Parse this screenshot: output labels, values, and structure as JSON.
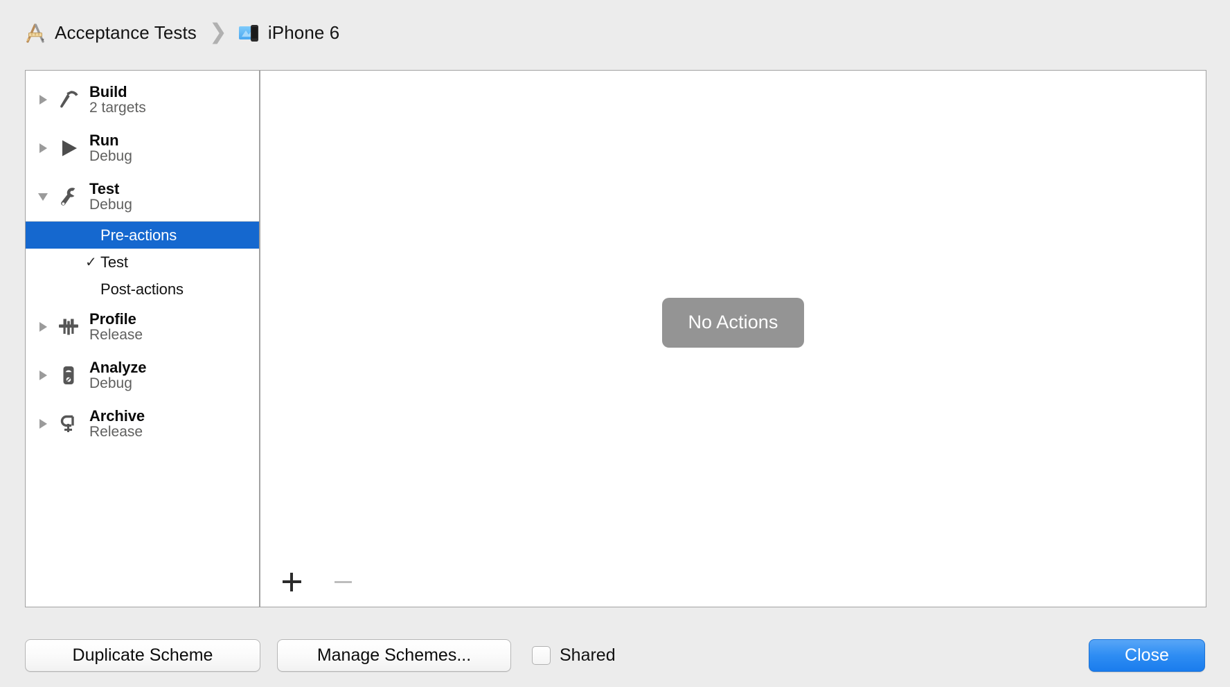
{
  "breadcrumb": {
    "scheme_icon": "scheme-icon",
    "scheme_name": "Acceptance Tests",
    "separator": "❯",
    "destination_icon": "simulator-device-icon",
    "destination_name": "iPhone 6"
  },
  "sidebar": {
    "groups": [
      {
        "icon": "hammer-icon",
        "title": "Build",
        "subtitle": "2 targets",
        "expanded": false,
        "children": []
      },
      {
        "icon": "play-triangle-icon",
        "title": "Run",
        "subtitle": "Debug",
        "expanded": false,
        "children": []
      },
      {
        "icon": "wrench-icon",
        "title": "Test",
        "subtitle": "Debug",
        "expanded": true,
        "children": [
          {
            "label": "Pre-actions",
            "checked": false,
            "selected": true
          },
          {
            "label": "Test",
            "checked": true,
            "selected": false
          },
          {
            "label": "Post-actions",
            "checked": false,
            "selected": false
          }
        ]
      },
      {
        "icon": "caliper-icon",
        "title": "Profile",
        "subtitle": "Release",
        "expanded": false,
        "children": []
      },
      {
        "icon": "analyze-gauge-icon",
        "title": "Analyze",
        "subtitle": "Debug",
        "expanded": false,
        "children": []
      },
      {
        "icon": "clamp-icon",
        "title": "Archive",
        "subtitle": "Release",
        "expanded": false,
        "children": []
      }
    ],
    "checkmark_glyph": "✓"
  },
  "content": {
    "empty_message": "No Actions",
    "toolbar": {
      "add_label": "+",
      "remove_label": "−"
    }
  },
  "footer": {
    "duplicate_scheme_label": "Duplicate Scheme",
    "manage_schemes_label": "Manage Schemes...",
    "shared_label": "Shared",
    "shared_checked": false,
    "close_label": "Close"
  },
  "colors": {
    "selection_blue": "#1568cf",
    "close_button_blue": "#2e8df3",
    "empty_pill_gray": "#949494",
    "window_background": "#ececec",
    "panel_border": "#a2a2a2"
  }
}
